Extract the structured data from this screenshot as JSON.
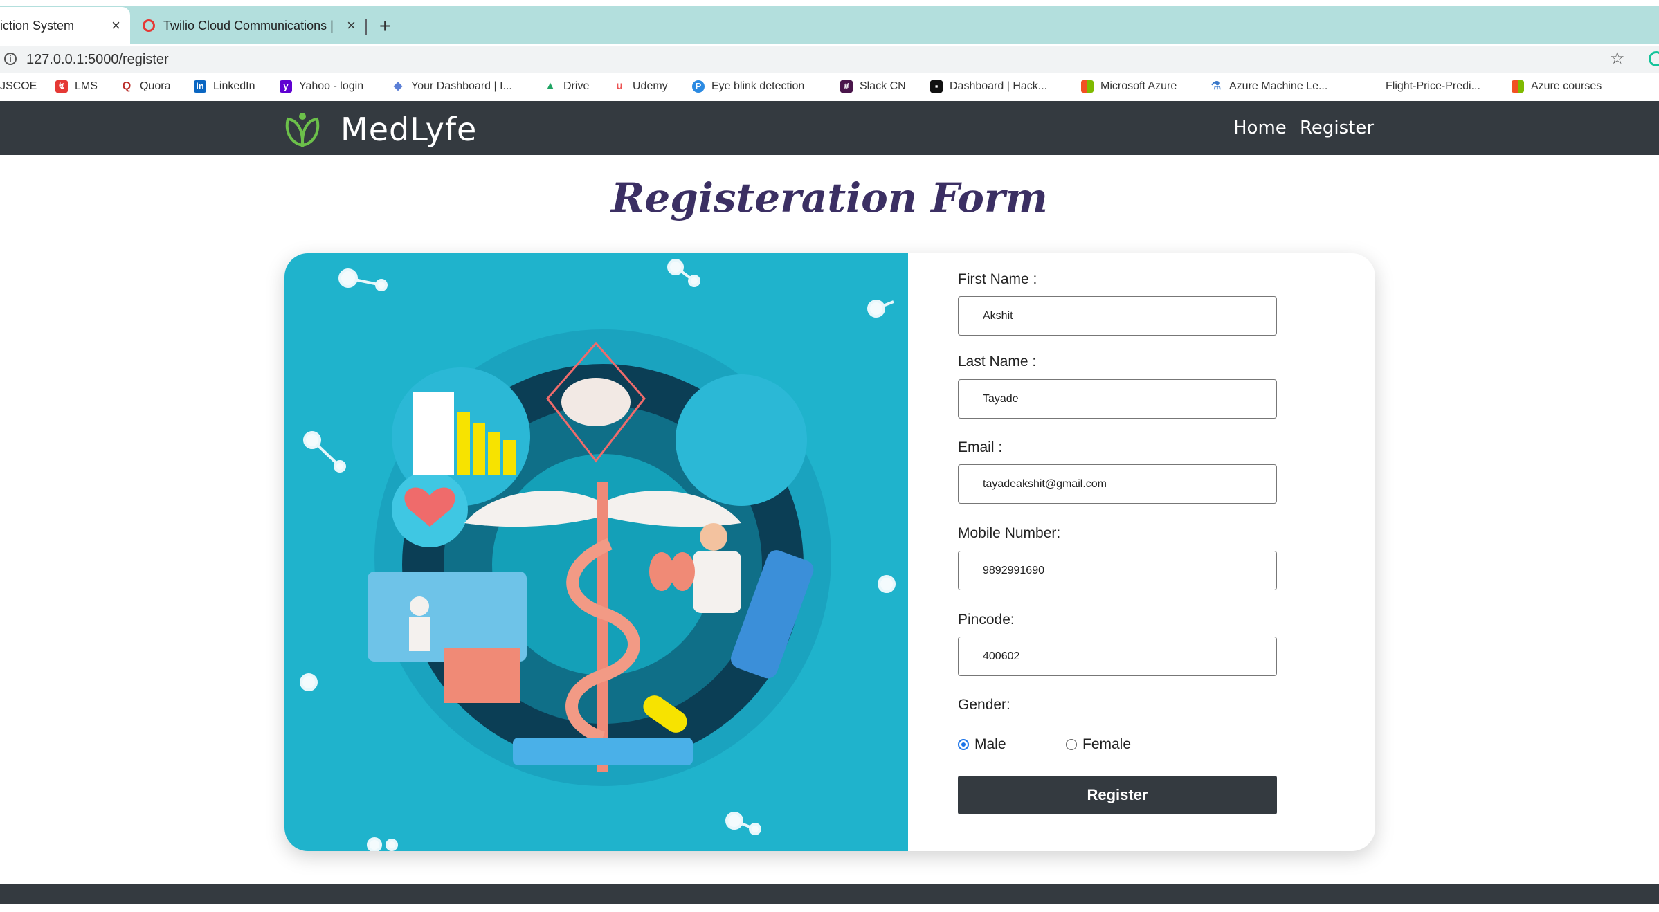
{
  "browser": {
    "tabs": [
      {
        "title": "iction System",
        "active": true
      },
      {
        "title": "Twilio Cloud Communications |",
        "active": false
      }
    ],
    "new_tab": "+",
    "close_glyph": "×",
    "url": "127.0.0.1:5000/register",
    "bookmarks": [
      {
        "label": "JSCOE",
        "icon": "none"
      },
      {
        "label": "LMS",
        "icon": "lms-icon"
      },
      {
        "label": "Quora",
        "icon": "quora-icon"
      },
      {
        "label": "LinkedIn",
        "icon": "linkedin-icon"
      },
      {
        "label": "Yahoo - login",
        "icon": "yahoo-icon"
      },
      {
        "label": "Your Dashboard | I...",
        "icon": "diamond-icon"
      },
      {
        "label": "Drive",
        "icon": "drive-icon"
      },
      {
        "label": "Udemy",
        "icon": "udemy-icon"
      },
      {
        "label": "Eye blink detection",
        "icon": "p-icon"
      },
      {
        "label": "Slack CN",
        "icon": "slack-icon"
      },
      {
        "label": "Dashboard | Hack...",
        "icon": "hack-icon"
      },
      {
        "label": "Microsoft Azure",
        "icon": "microsoft-icon"
      },
      {
        "label": "Azure Machine Le...",
        "icon": "flask-icon"
      },
      {
        "label": "Flight-Price-Predi...",
        "icon": "none"
      },
      {
        "label": "Azure courses",
        "icon": "microsoft-icon"
      }
    ]
  },
  "navbar": {
    "brand": "MedLyfe",
    "links": [
      "Home",
      "Register"
    ]
  },
  "form": {
    "title": "Registeration Form",
    "fields": [
      {
        "label": "First Name :",
        "value": "Akshit"
      },
      {
        "label": "Last Name :",
        "value": "Tayade"
      },
      {
        "label": "Email :",
        "value": "tayadeakshit@gmail.com"
      },
      {
        "label": "Mobile Number:",
        "value": "9892991690"
      },
      {
        "label": "Pincode:",
        "value": "400602"
      }
    ],
    "gender": {
      "label": "Gender:",
      "options": [
        "Male",
        "Female"
      ],
      "selected": "Male"
    },
    "submit": "Register"
  },
  "colors": {
    "navbar": "#343a40",
    "title": "#3b2f63",
    "illustration_bg": "#1fb3cc",
    "tabstrip": "#b3dfdd",
    "radio_selected": "#1a73e8",
    "logo_green": "#6cc04a"
  }
}
